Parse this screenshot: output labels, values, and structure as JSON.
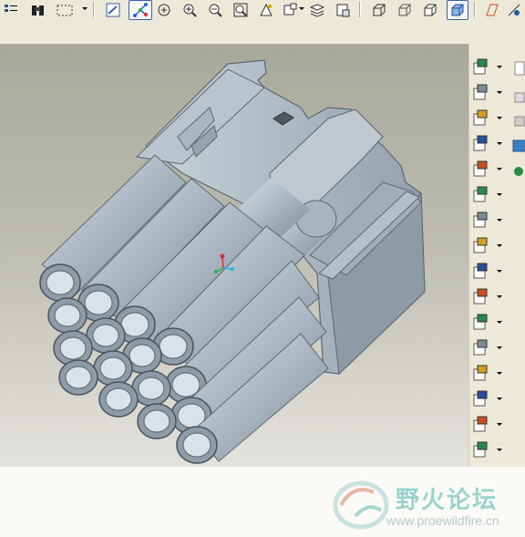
{
  "toolbar": {
    "buttons": [
      {
        "icon": "list-icon"
      },
      {
        "icon": "binoculars-icon"
      },
      {
        "icon": "select-box-icon"
      },
      {
        "icon": "repaint-icon"
      },
      {
        "icon": "spin-center-icon",
        "active": true
      },
      {
        "icon": "orient-icon"
      },
      {
        "icon": "zoom-in-icon"
      },
      {
        "icon": "zoom-out-icon"
      },
      {
        "icon": "refit-icon"
      },
      {
        "icon": "reorient-icon"
      },
      {
        "icon": "saved-views-icon"
      },
      {
        "icon": "layers-icon"
      },
      {
        "icon": "setup-view-icon"
      },
      {
        "icon": "wireframe-icon"
      },
      {
        "icon": "hidden-line-icon"
      },
      {
        "icon": "no-hidden-icon"
      },
      {
        "icon": "shading-icon",
        "active": true
      },
      {
        "icon": "datum-plane-icon"
      },
      {
        "icon": "datum-axis-icon"
      }
    ]
  },
  "right_toolbar": {
    "buttons": [
      "flat-pattern-icon",
      "sketched-wall-icon",
      "hole-icon",
      "round-icon",
      "extrude-wall-icon",
      "datum-point-icon",
      "edit-icon",
      "sketch-icon",
      "pattern-icon",
      "mirror-icon",
      "bend-icon",
      "unbend-icon",
      "form-icon",
      "rip-icon",
      "corner-relief-icon",
      "unfold-icon"
    ]
  },
  "colors": {
    "body": "#a6b3bd",
    "body_light": "#c7d2da",
    "body_dark": "#76848f",
    "background_top": "#a8a89b",
    "background_bottom": "#e3e2dc"
  },
  "watermark": {
    "chinese": "野火论坛",
    "url": "www.proewildfire.cn"
  }
}
